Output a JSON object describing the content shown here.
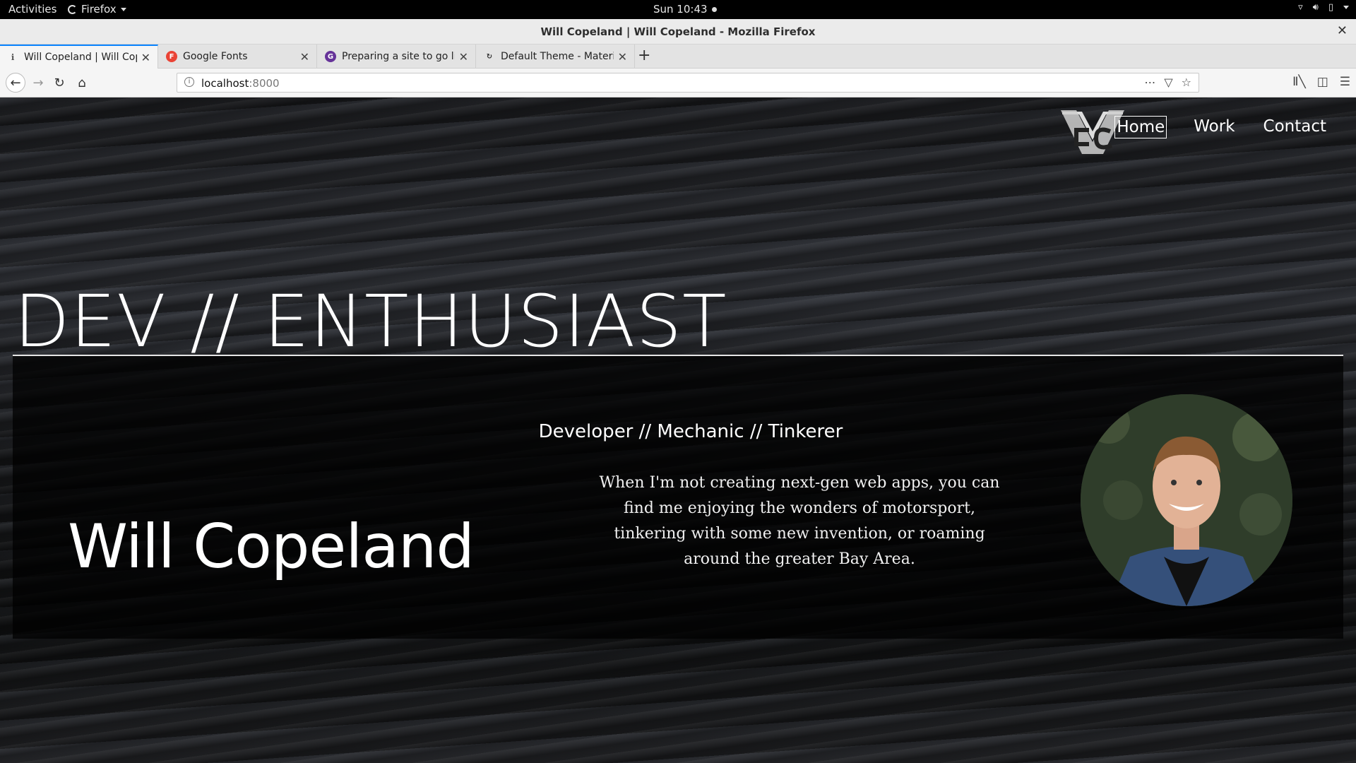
{
  "system_bar": {
    "activities": "Activities",
    "app": "Firefox",
    "clock": "Sun 10:43"
  },
  "window": {
    "title": "Will Copeland | Will Copeland - Mozilla Firefox"
  },
  "tabs": [
    {
      "label": "Will Copeland | Will Copeland",
      "favicon": "page-icon",
      "active": true
    },
    {
      "label": "Google Fonts",
      "favicon": "google-fonts-icon",
      "favicon_color": "#ea4335",
      "active": false
    },
    {
      "label": "Preparing a site to go live",
      "favicon": "gatsby-icon",
      "favicon_color": "#663399",
      "active": false
    },
    {
      "label": "Default Theme - Material",
      "favicon": "material-icon",
      "active": false
    }
  ],
  "urlbar": {
    "host": "localhost",
    "port": ":8000"
  },
  "site": {
    "logo_text": "WC",
    "nav": [
      {
        "label": "Home",
        "current": true
      },
      {
        "label": "Work",
        "current": false
      },
      {
        "label": "Contact",
        "current": false
      }
    ],
    "hero_title": "DEV // ENTHUSIAST",
    "name": "Will Copeland",
    "subtitle": "Developer // Mechanic // Tinkerer",
    "bio": "When I'm not creating next-gen web apps, you can find me enjoying the wonders of motorsport, tinkering with some new invention, or roaming around the greater Bay Area."
  },
  "colors": {
    "accent": "#0a84ff",
    "page_bg": "#1a1b1e",
    "text": "#ffffff"
  }
}
